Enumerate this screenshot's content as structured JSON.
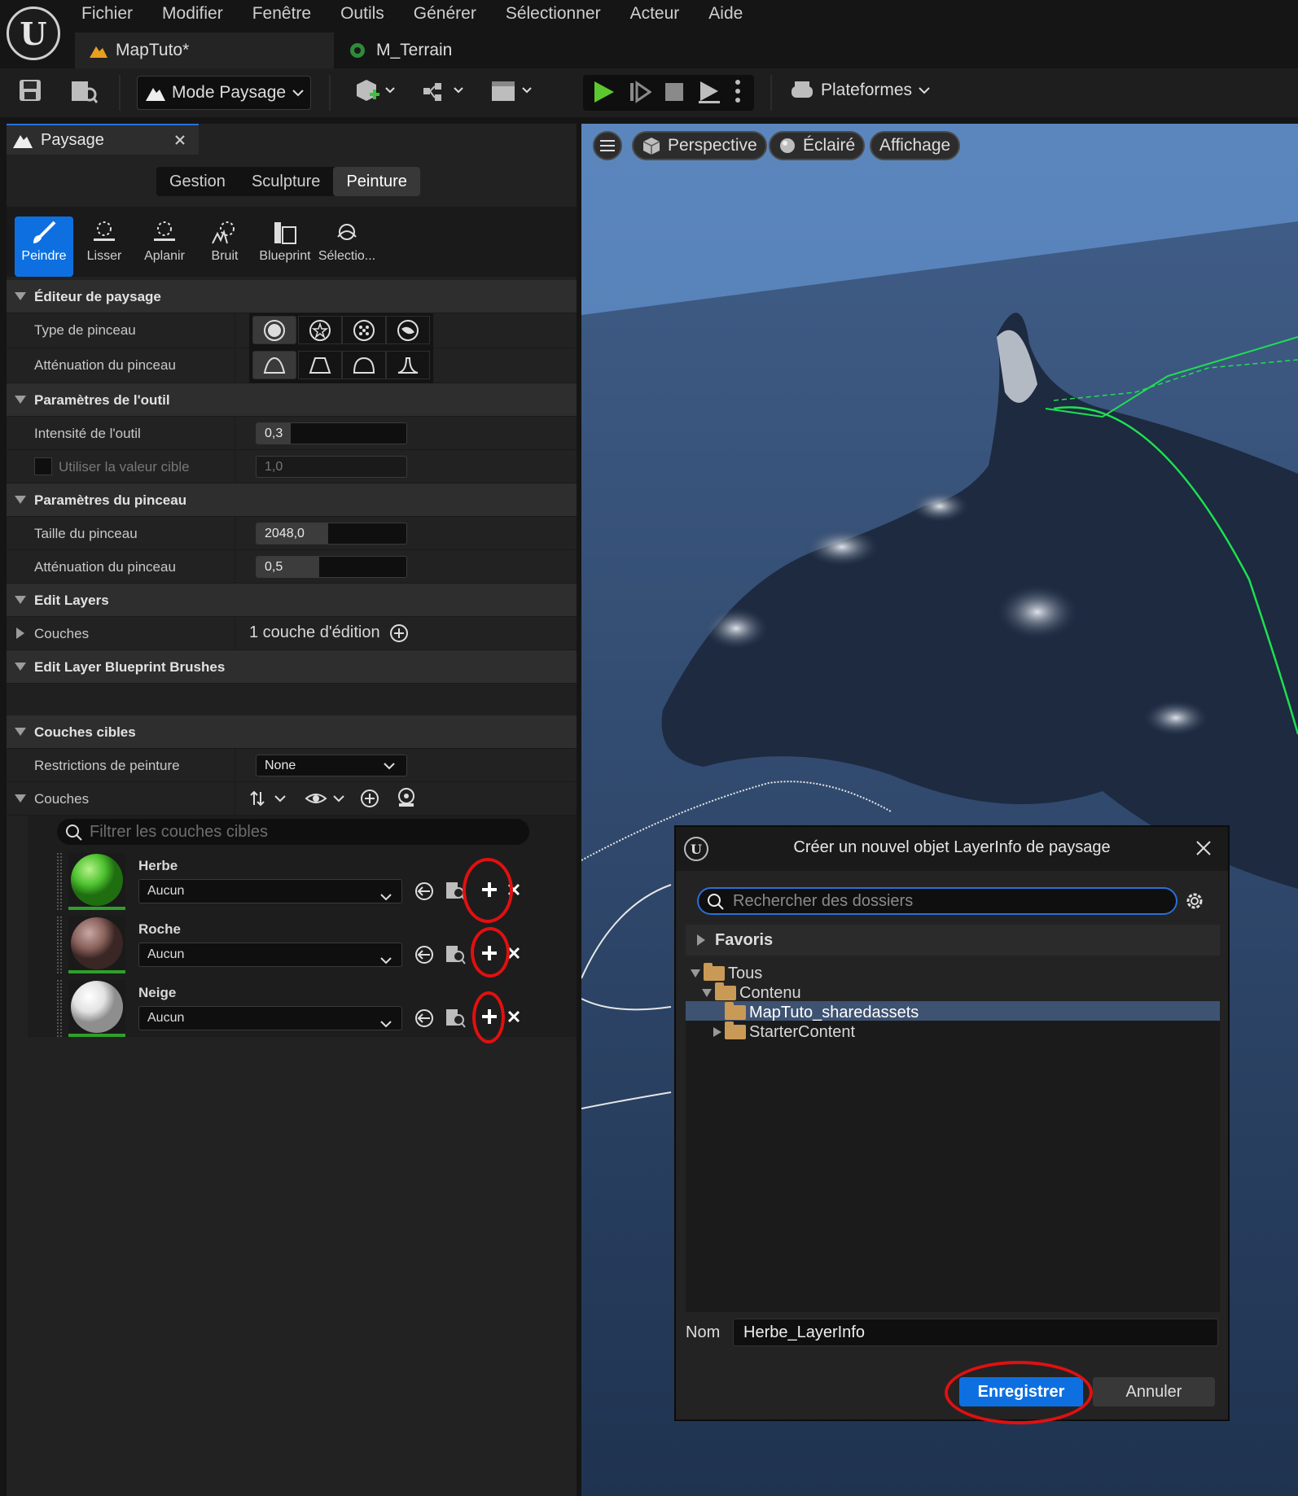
{
  "menu": [
    "Fichier",
    "Modifier",
    "Fenêtre",
    "Outils",
    "Générer",
    "Sélectionner",
    "Acteur",
    "Aide"
  ],
  "tabs": {
    "level": "MapTuto*",
    "material": "M_Terrain"
  },
  "toolbar": {
    "mode": "Mode Paysage",
    "platforms": "Plateformes"
  },
  "panel": {
    "title": "Paysage",
    "modes": [
      "Gestion",
      "Sculpture",
      "Peinture"
    ],
    "active_mode": "Peinture",
    "tools": [
      "Peindre",
      "Lisser",
      "Aplanir",
      "Bruit",
      "Blueprint",
      "Sélectio..."
    ],
    "sections": {
      "editor": "Éditeur de paysage",
      "brush_type": "Type de pinceau",
      "brush_falloff": "Atténuation du pinceau",
      "tool_params": "Paramètres de l'outil",
      "tool_strength": "Intensité de l'outil",
      "tool_strength_val": "0,3",
      "use_target": "Utiliser la valeur cible",
      "use_target_val": "1,0",
      "brush_params": "Paramètres du pinceau",
      "brush_size": "Taille du pinceau",
      "brush_size_val": "2048,0",
      "brush_falloff2": "Atténuation du pinceau",
      "brush_falloff2_val": "0,5",
      "edit_layers": "Edit Layers",
      "layers": "Couches",
      "layers_val": "1 couche d'édition",
      "edit_layer_bp": "Edit Layer Blueprint Brushes",
      "target_layers": "Couches cibles",
      "paint_restrict": "Restrictions de peinture",
      "paint_restrict_val": "None",
      "target_couches": "Couches",
      "filter_placeholder": "Filtrer les couches cibles"
    },
    "layer_list": [
      {
        "name": "Herbe",
        "info": "Aucun",
        "color": "#58c23a"
      },
      {
        "name": "Roche",
        "info": "Aucun",
        "color": "#8c6a66"
      },
      {
        "name": "Neige",
        "info": "Aucun",
        "color": "#e8e8e8"
      }
    ]
  },
  "viewport": {
    "perspective": "Perspective",
    "lit": "Éclairé",
    "show": "Affichage"
  },
  "dialog": {
    "title": "Créer un nouvel objet LayerInfo de paysage",
    "search_placeholder": "Rechercher des dossiers",
    "favorites": "Favoris",
    "tree": [
      "Tous",
      "Contenu",
      "MapTuto_sharedassets",
      "StarterContent"
    ],
    "name_label": "Nom",
    "name_value": "Herbe_LayerInfo",
    "save": "Enregistrer",
    "cancel": "Annuler"
  },
  "colors": {
    "accent": "#0e70e0",
    "highlight": "#e01010",
    "selected_row": "#3e5272"
  }
}
